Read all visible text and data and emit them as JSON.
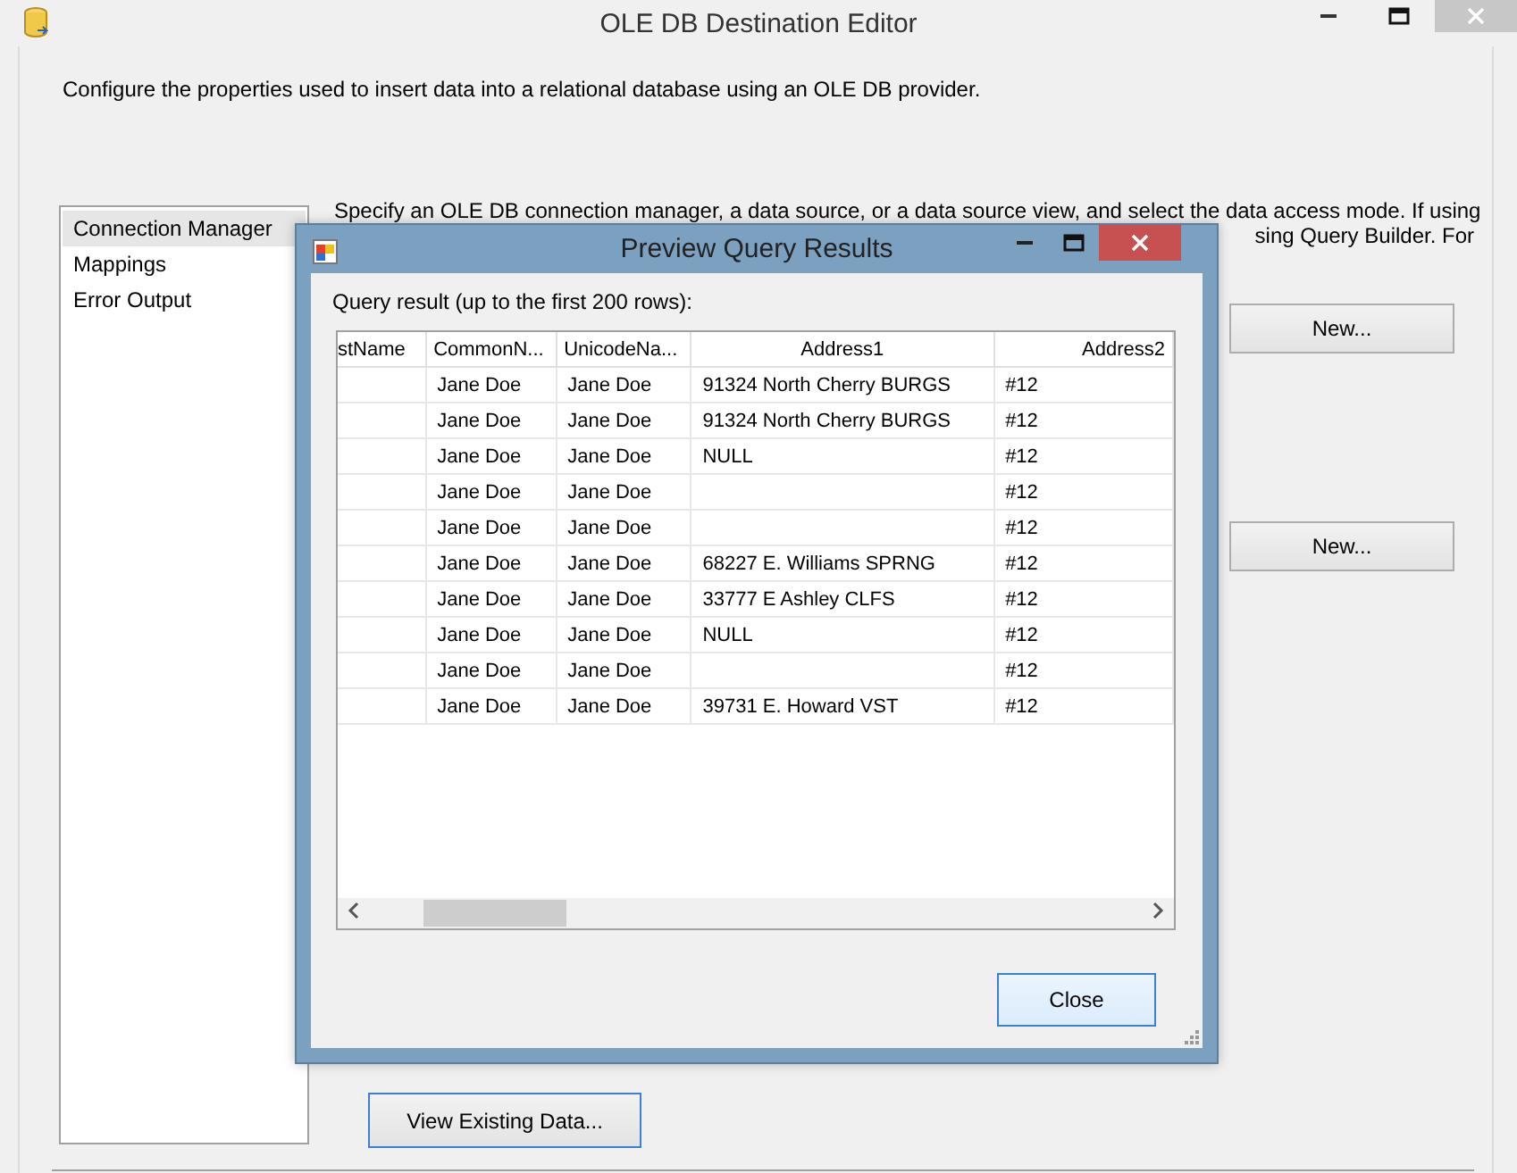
{
  "window": {
    "title": "OLE DB Destination Editor"
  },
  "description": "Configure the properties used to insert data into a relational database using an OLE DB provider.",
  "sidebar": {
    "items": [
      {
        "label": "Connection Manager",
        "selected": true
      },
      {
        "label": "Mappings",
        "selected": false
      },
      {
        "label": "Error Output",
        "selected": false
      }
    ]
  },
  "instructions": [
    "Specify an OLE DB connection manager, a data source, or a data source view, and select the data access mode. If using",
    "sing Query Builder. For"
  ],
  "new_buttons": [
    "New...",
    "New..."
  ],
  "view_button": "View Existing Data...",
  "dialog": {
    "title": "Preview Query Results",
    "caption": "Query result (up to the first 200 rows):",
    "table": {
      "columns": [
        "stName",
        "CommonN...",
        "UnicodeNa...",
        "Address1",
        "Address2"
      ],
      "rows": [
        [
          "",
          "Jane Doe",
          "Jane Doe",
          "91324 North Cherry BURGS",
          "#12"
        ],
        [
          "",
          "Jane Doe",
          "Jane Doe",
          "91324 North Cherry BURGS",
          "#12"
        ],
        [
          "",
          "Jane Doe",
          "Jane Doe",
          "NULL",
          "#12"
        ],
        [
          "",
          "Jane Doe",
          "Jane Doe",
          "",
          "#12"
        ],
        [
          "",
          "Jane Doe",
          "Jane Doe",
          "",
          "#12"
        ],
        [
          "",
          "Jane Doe",
          "Jane Doe",
          "68227 E. Williams SPRNG",
          "#12"
        ],
        [
          "",
          "Jane Doe",
          "Jane Doe",
          "33777 E Ashley CLFS",
          "#12"
        ],
        [
          "",
          "Jane Doe",
          "Jane Doe",
          "NULL",
          "#12"
        ],
        [
          "",
          "Jane Doe",
          "Jane Doe",
          "",
          "#12"
        ],
        [
          "",
          "Jane Doe",
          "Jane Doe",
          "39731 E. Howard VST",
          "#12"
        ]
      ]
    },
    "close_button": "Close"
  }
}
